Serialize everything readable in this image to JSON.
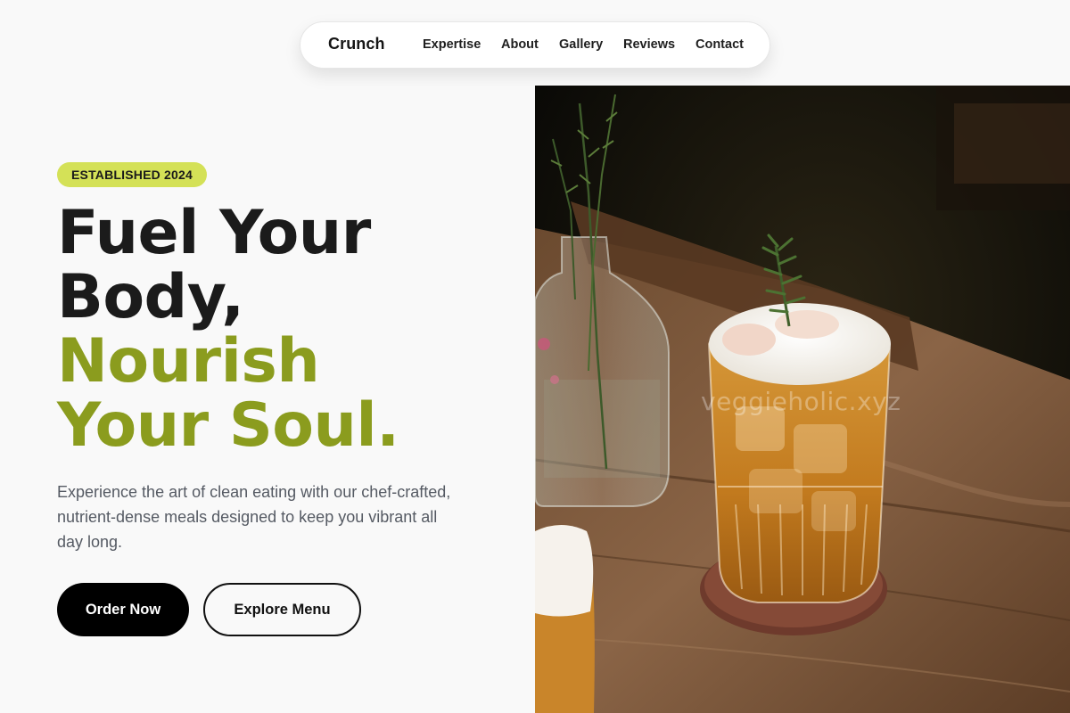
{
  "nav": {
    "brand": "Crunch",
    "links": [
      "Expertise",
      "About",
      "Gallery",
      "Reviews",
      "Contact"
    ]
  },
  "hero": {
    "badge": "ESTABLISHED 2024",
    "headline": {
      "line1": "Fuel Your",
      "line2": "Body,",
      "line3": "Nourish",
      "line4": "Your Soul."
    },
    "description": "Experience the art of clean eating with our chef-crafted, nutrient-dense meals designed to keep you vibrant all day long.",
    "primary_button": "Order Now",
    "secondary_button": "Explore Menu"
  },
  "image": {
    "watermark": "veggieholic.xyz"
  },
  "colors": {
    "accent_green": "#8b9c1e",
    "badge_bg": "#d4e157",
    "primary_button_bg": "#000000"
  }
}
